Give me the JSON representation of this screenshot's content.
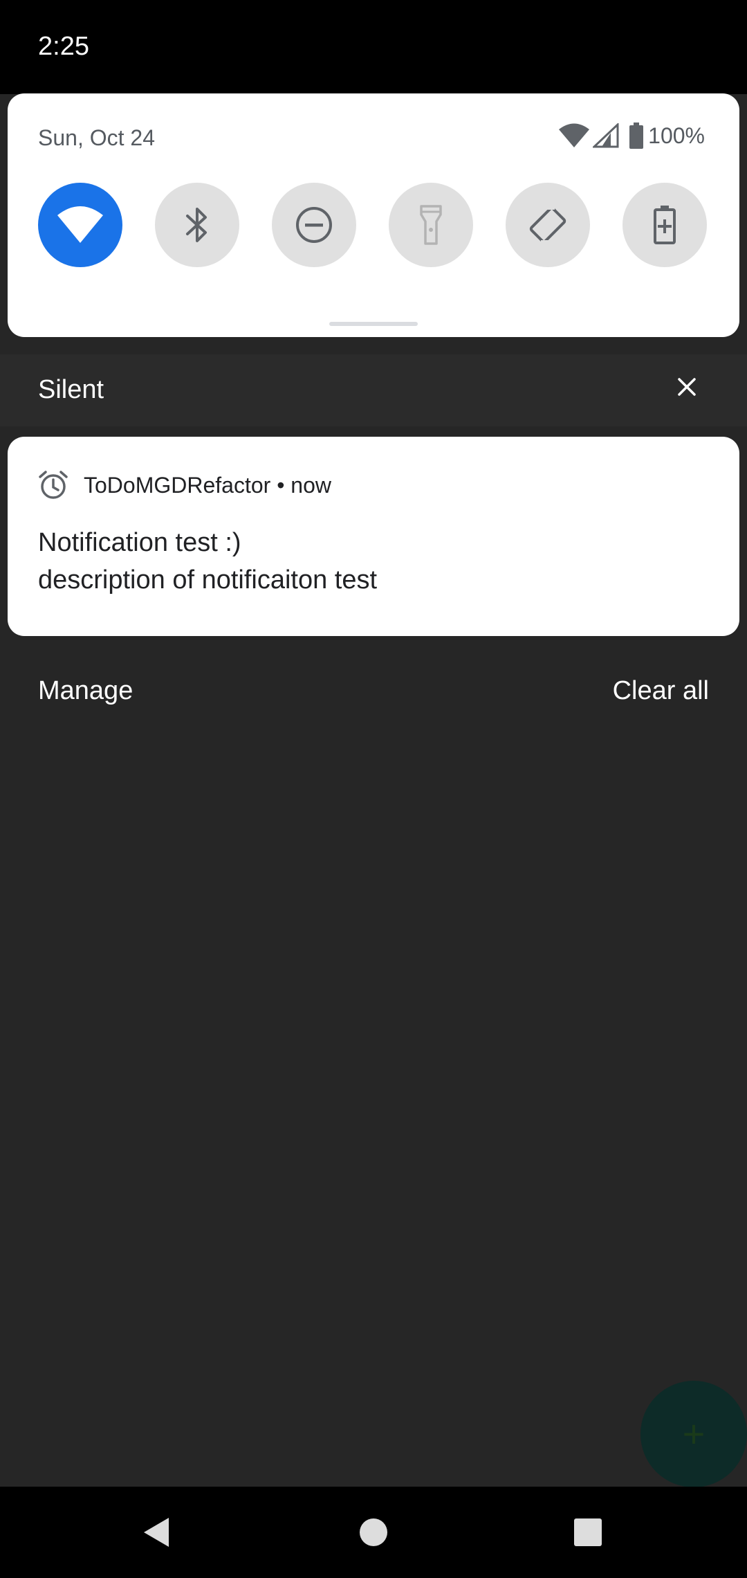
{
  "status_bar": {
    "time": "2:25"
  },
  "quick_settings": {
    "date": "Sun, Oct 24",
    "battery_percent": "100%",
    "tiles": [
      {
        "name": "wifi",
        "icon": "wifi-icon",
        "active": true
      },
      {
        "name": "bluetooth",
        "icon": "bluetooth-icon",
        "active": false
      },
      {
        "name": "do-not-disturb",
        "icon": "do-not-disturb-icon",
        "active": false
      },
      {
        "name": "flashlight",
        "icon": "flashlight-icon",
        "active": false
      },
      {
        "name": "auto-rotate",
        "icon": "auto-rotate-icon",
        "active": false
      },
      {
        "name": "battery-saver",
        "icon": "battery-saver-icon",
        "active": false
      }
    ],
    "accent_color": "#1a73e8"
  },
  "silent_section": {
    "label": "Silent"
  },
  "notification": {
    "app_name": "ToDoMGDRefactor",
    "separator": "•",
    "time": "now",
    "header_text": "ToDoMGDRefactor • now",
    "icon": "alarm-icon",
    "title": "Notification test :)",
    "text": "description of notificaiton test"
  },
  "footer": {
    "manage_label": "Manage",
    "clear_all_label": "Clear all"
  },
  "fab": {
    "icon": "plus-icon",
    "glyph": "+"
  },
  "nav_bar": {
    "back": "back-icon",
    "home": "home-icon",
    "recents": "recents-icon"
  }
}
